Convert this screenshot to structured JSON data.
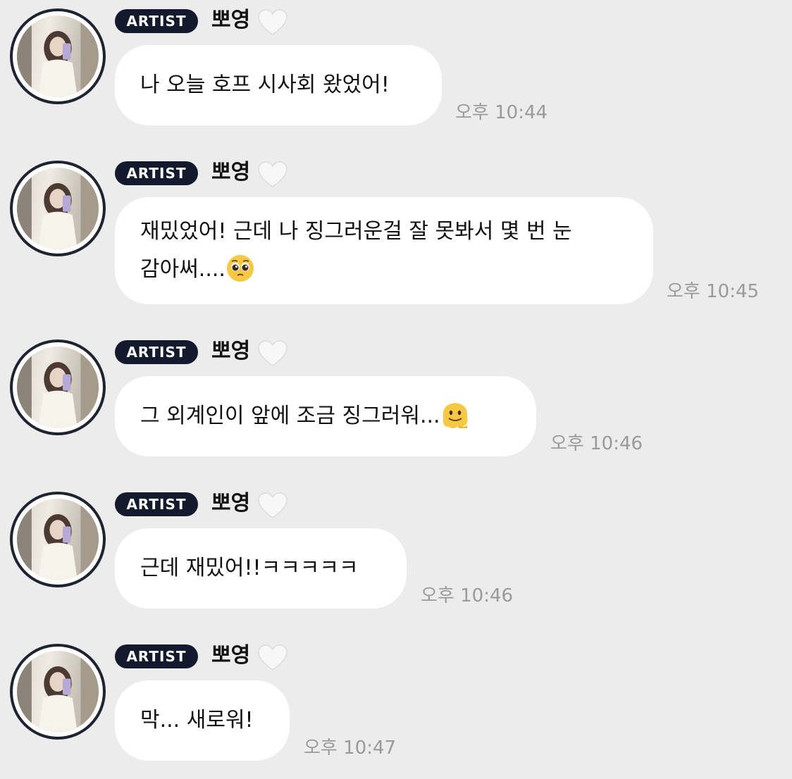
{
  "messages": [
    {
      "badge": "ARTIST",
      "name": "뽀영",
      "lines": [
        "나 오늘 호프 시사회 왔었어!"
      ],
      "time": "오후 10:44"
    },
    {
      "badge": "ARTIST",
      "name": "뽀영",
      "lines": [
        "재밌었어! 근데 나 징그러운걸 잘 못봐서 몇 번 눈",
        "감아써...."
      ],
      "emoji": "pleading-face-emoji",
      "time": "오후 10:45"
    },
    {
      "badge": "ARTIST",
      "name": "뽀영",
      "lines": [
        "그 외계인이 앞에 조금 징그러워..."
      ],
      "emoji": "melting-face-emoji",
      "time": "오후 10:46"
    },
    {
      "badge": "ARTIST",
      "name": "뽀영",
      "lines": [
        "근데 재밌어!!ㅋㅋㅋㅋㅋ"
      ],
      "time": "오후 10:46"
    },
    {
      "badge": "ARTIST",
      "name": "뽀영",
      "lines": [
        "막... 새로워!"
      ],
      "time": "오후 10:47"
    }
  ],
  "colors": {
    "background": "#ececec",
    "bubble": "#ffffff",
    "badge": "#141a2e",
    "time": "#9a9a9a"
  },
  "icons": [
    "white-heart-icon",
    "avatar-photo"
  ]
}
